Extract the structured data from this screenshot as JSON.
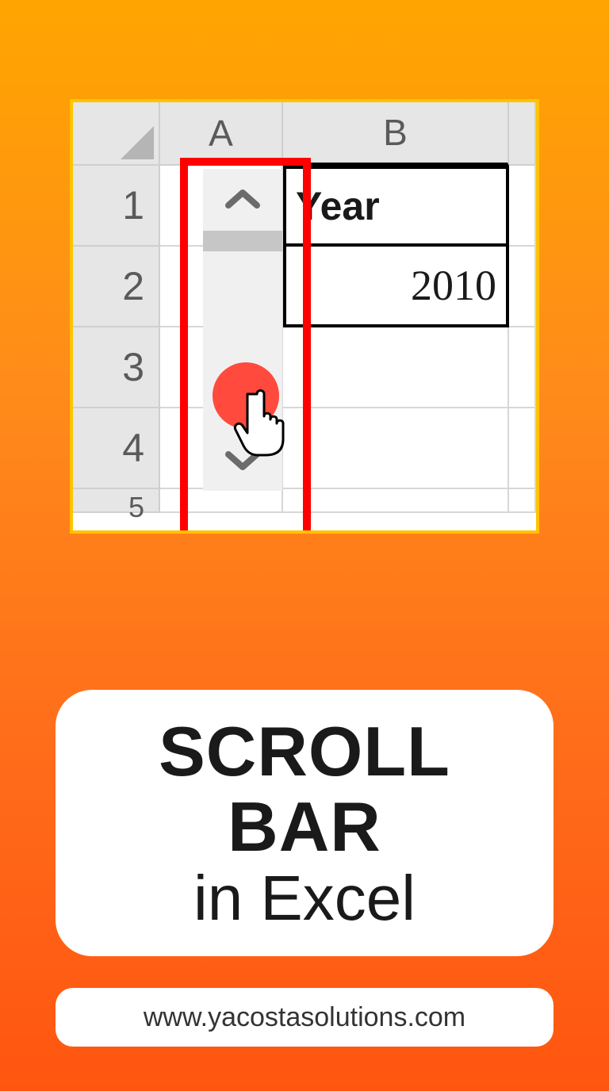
{
  "excel": {
    "columns": [
      "A",
      "B"
    ],
    "rows": [
      "1",
      "2",
      "3",
      "4",
      "5"
    ],
    "b1": "Year",
    "b2": "2010"
  },
  "title": {
    "line1": "SCROLL",
    "line2": "BAR",
    "line3": "in Excel"
  },
  "url": "www.yacostasolutions.com"
}
